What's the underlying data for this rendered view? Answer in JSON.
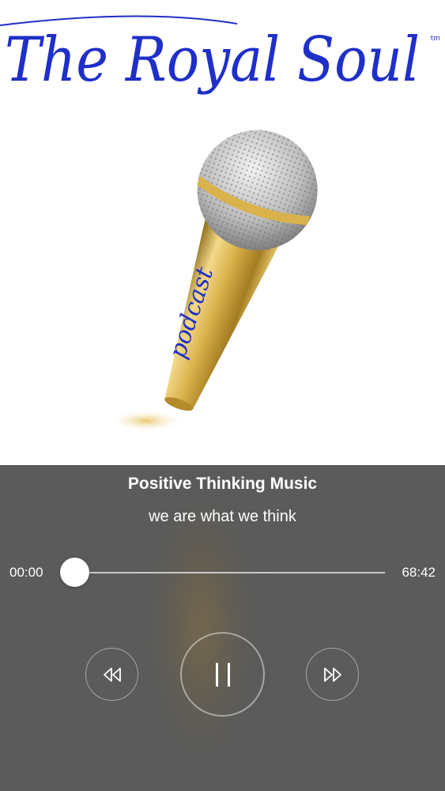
{
  "artwork": {
    "logo_text": "The Royal Soul",
    "trademark": "tm",
    "mic_label": "podcast"
  },
  "player": {
    "title": "Positive Thinking Music",
    "subtitle": "we are what we think",
    "elapsed": "00:00",
    "duration": "68:42",
    "progress": 0.0,
    "state": "playing"
  },
  "colors": {
    "logo_blue": "#1f2fc9",
    "panel_bg": "#5b5b5b",
    "gold": "#d4a93a"
  },
  "icons": {
    "rewind": "rewind-icon",
    "pause": "pause-icon",
    "forward": "fast-forward-icon"
  }
}
